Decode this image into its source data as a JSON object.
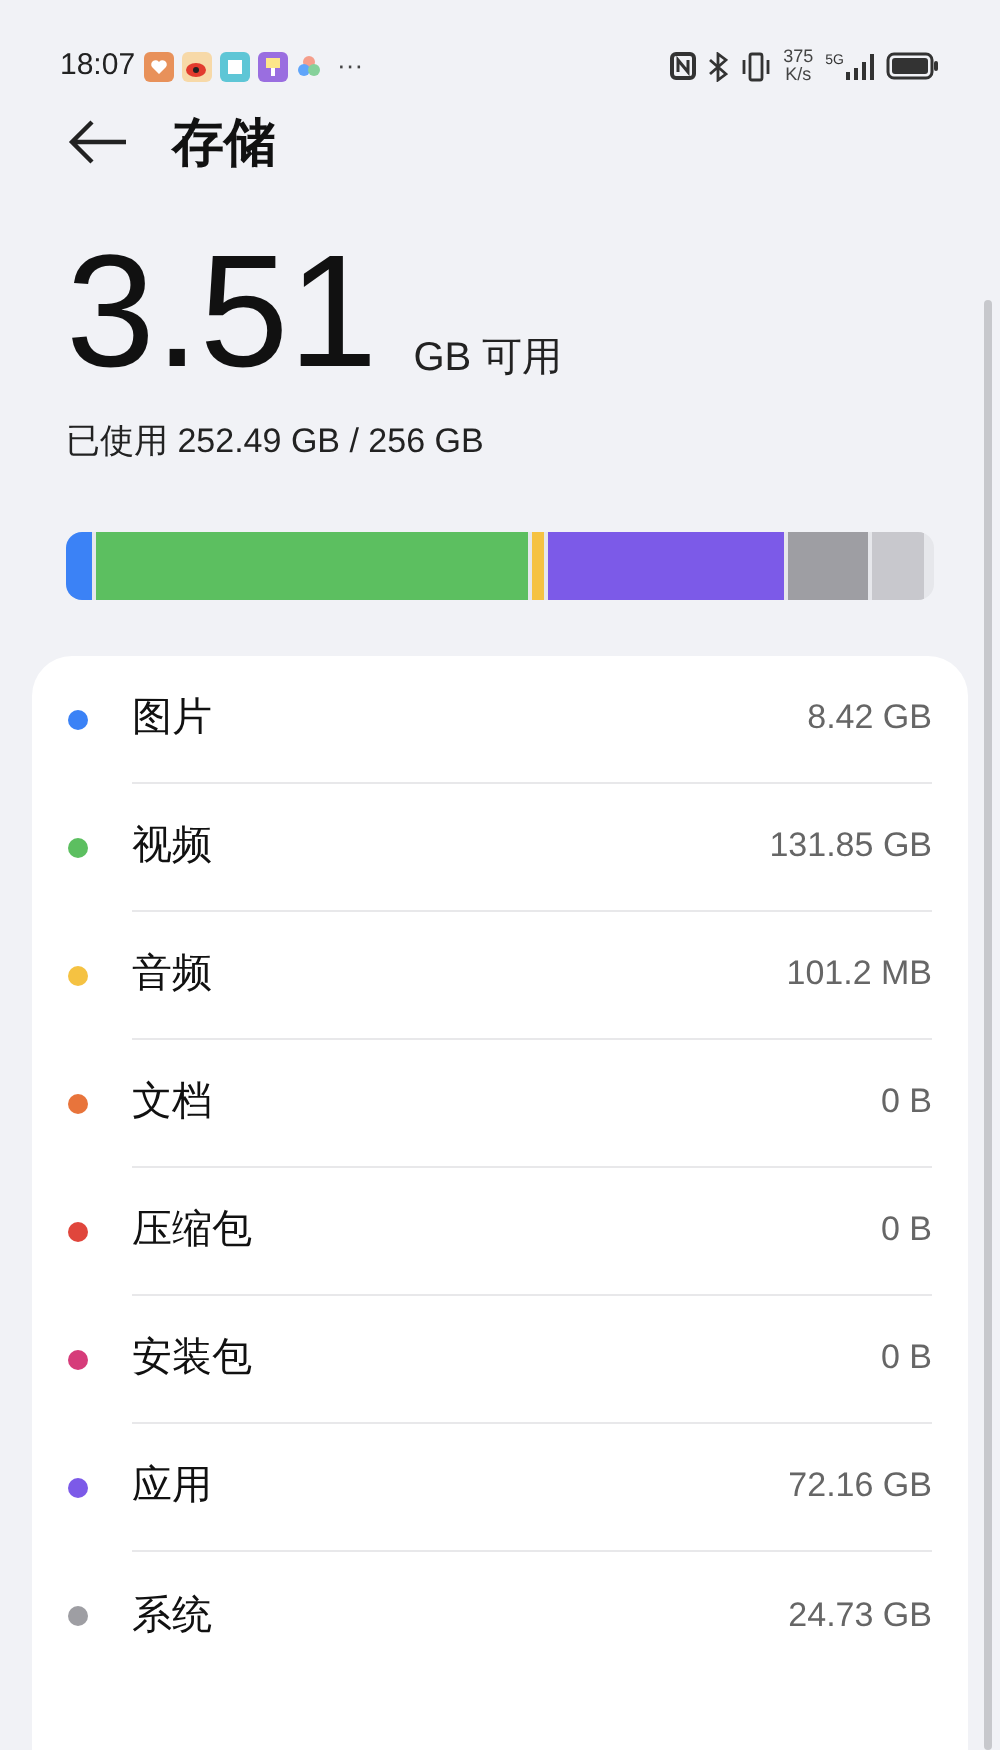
{
  "status_bar": {
    "time": "18:07",
    "more": "···",
    "net_speed": "375",
    "net_unit": "K/s",
    "network": "5G"
  },
  "header": {
    "title": "存储"
  },
  "summary": {
    "free_value": "3.51",
    "free_unit": "GB 可用",
    "used": "已使用 252.49 GB / 256 GB"
  },
  "usage_bar": [
    {
      "color": "#3b82f6"
    },
    {
      "color": "#5cbf60"
    },
    {
      "color": "#f5c242"
    },
    {
      "color": "#7c5ae8"
    },
    {
      "color": "#9e9ea3"
    },
    {
      "color": "#c8c8cd"
    }
  ],
  "categories": [
    {
      "name": "图片",
      "size": "8.42 GB",
      "color": "#3b82f6"
    },
    {
      "name": "视频",
      "size": "131.85 GB",
      "color": "#5cbf60"
    },
    {
      "name": "音频",
      "size": "101.2 MB",
      "color": "#f5c242"
    },
    {
      "name": "文档",
      "size": "0 B",
      "color": "#e8743b"
    },
    {
      "name": "压缩包",
      "size": "0 B",
      "color": "#e0463c"
    },
    {
      "name": "安装包",
      "size": "0 B",
      "color": "#d63c7a"
    },
    {
      "name": "应用",
      "size": "72.16 GB",
      "color": "#7c5ae8"
    },
    {
      "name": "系统",
      "size": "24.73 GB",
      "color": "#9e9ea3"
    }
  ]
}
